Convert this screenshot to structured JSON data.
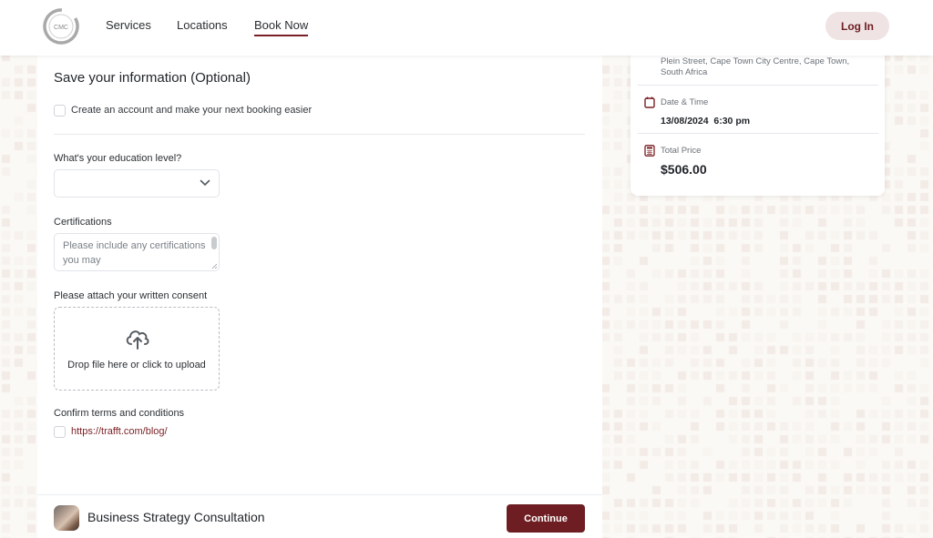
{
  "header": {
    "logo_text": "CMC",
    "nav": [
      {
        "label": "Services",
        "active": false
      },
      {
        "label": "Locations",
        "active": false
      },
      {
        "label": "Book Now",
        "active": true
      }
    ],
    "login_label": "Log In"
  },
  "form": {
    "section_title": "Save your information (Optional)",
    "create_account": {
      "label": "Create an account and make your next booking easier",
      "checked": false
    },
    "education": {
      "label": "What's your education level?",
      "value": ""
    },
    "certifications": {
      "label": "Certifications",
      "placeholder": "Please include any certifications you may"
    },
    "consent": {
      "label": "Please attach your written consent",
      "upload_text": "Drop file here or click to upload"
    },
    "terms": {
      "label": "Confirm terms and conditions",
      "link": "https://trafft.com/blog/",
      "checked": false
    }
  },
  "footer": {
    "service_name": "Business Strategy Consultation",
    "continue_label": "Continue"
  },
  "summary": {
    "address": "Plein Street, Cape Town City Centre, Cape Town, South Africa",
    "date_time_label": "Date & Time",
    "date_time_value": "13/08/2024  6:30 pm",
    "total_price_label": "Total Price",
    "total_price_value": "$506.00"
  },
  "colors": {
    "brand": "#6e1e23",
    "brand_light": "#efe3e3",
    "link": "#7a1f24",
    "background": "#fbf9f5"
  }
}
